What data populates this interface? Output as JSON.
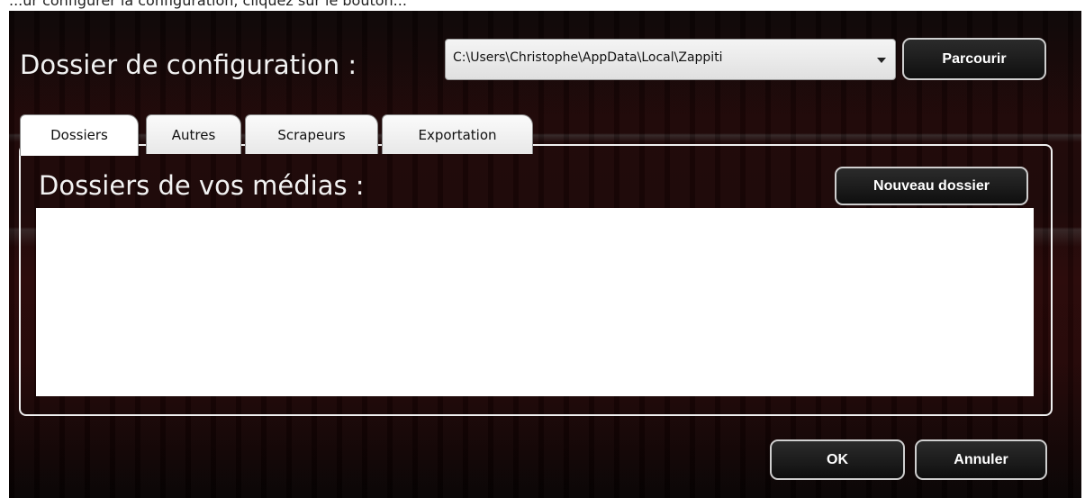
{
  "top_strip": {
    "text": "...ur configurer la configuration, cliquez sur le bouton..."
  },
  "config": {
    "title": "Dossier de configuration :",
    "path_value": "C:\\Users\\Christophe\\AppData\\Local\\Zappiti",
    "browse_label": "Parcourir"
  },
  "tabs": [
    {
      "label": "Dossiers",
      "active": true
    },
    {
      "label": "Autres",
      "active": false
    },
    {
      "label": "Scrapeurs",
      "active": false
    },
    {
      "label": "Exportation",
      "active": false
    }
  ],
  "media": {
    "title": "Dossiers de vos médias :",
    "new_folder_label": "Nouveau dossier",
    "folders": []
  },
  "footer": {
    "ok_label": "OK",
    "cancel_label": "Annuler"
  }
}
